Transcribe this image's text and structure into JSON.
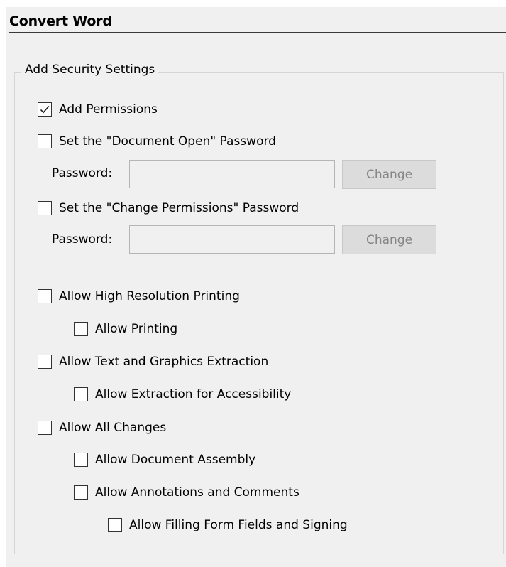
{
  "header": {
    "title": "Convert Word"
  },
  "security": {
    "legend": "Add Security Settings",
    "add_permissions": {
      "label": "Add Permissions",
      "checked": true
    },
    "open_password": {
      "label": "Set the \"Document Open\" Password",
      "checked": false,
      "password_label": "Password:",
      "password_value": "",
      "change_label": "Change"
    },
    "change_password": {
      "label": "Set the \"Change Permissions\" Password",
      "checked": false,
      "password_label": "Password:",
      "password_value": "",
      "change_label": "Change"
    },
    "permissions": [
      {
        "label": "Allow High Resolution Printing",
        "checked": false
      },
      {
        "label": "Allow Printing",
        "checked": false
      },
      {
        "label": "Allow Text and Graphics Extraction",
        "checked": false
      },
      {
        "label": "Allow Extraction for Accessibility",
        "checked": false
      },
      {
        "label": "Allow All Changes",
        "checked": false
      },
      {
        "label": "Allow Document Assembly",
        "checked": false
      },
      {
        "label": "Allow Annotations and Comments",
        "checked": false
      },
      {
        "label": "Allow Filling Form Fields and Signing",
        "checked": false
      }
    ]
  },
  "colors": {
    "panel_bg": "#f0f0f0",
    "header_rule": "#3a3a3a",
    "disabled_button_bg": "#dcdcdc",
    "disabled_button_text": "#858585"
  }
}
